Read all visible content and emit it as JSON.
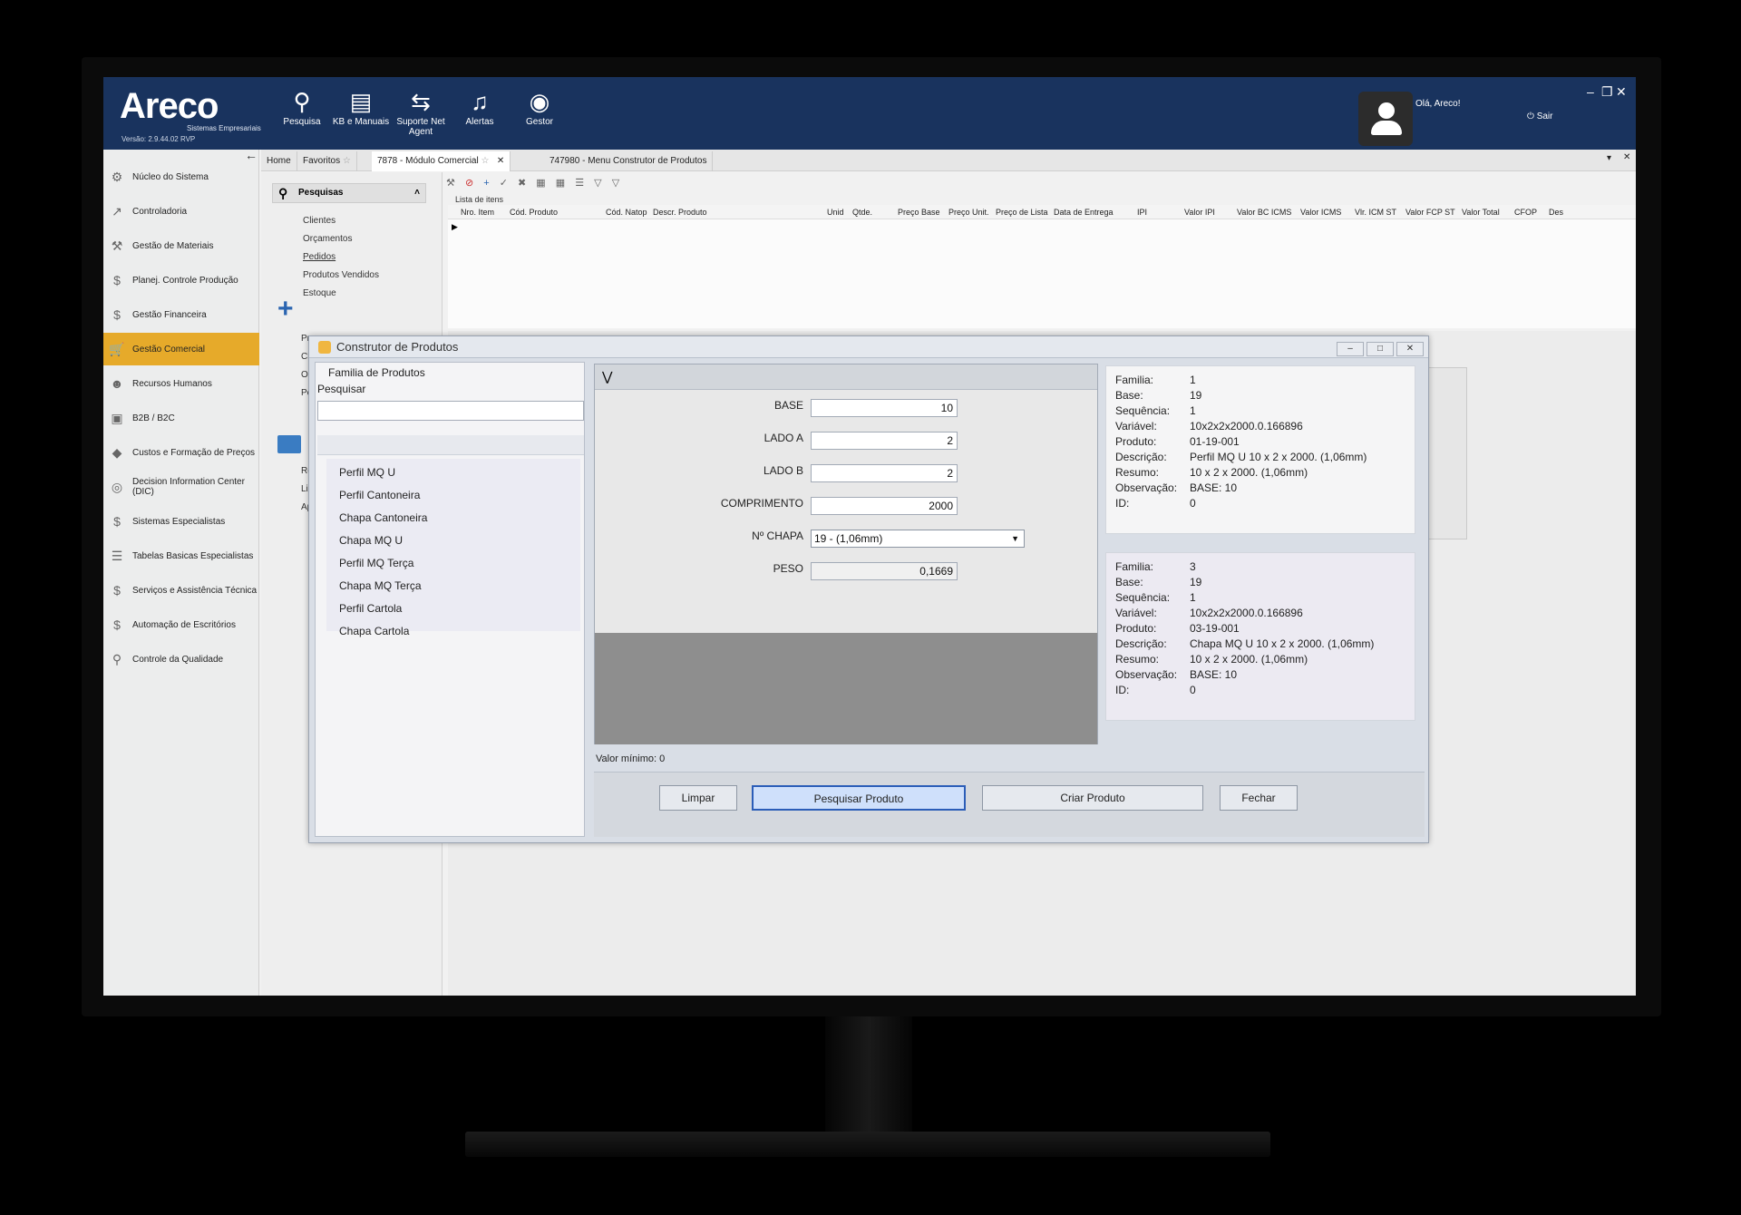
{
  "app": {
    "logo": "Areco",
    "logo_sub": "Sistemas Empresariais",
    "version": "Versão: 2.9.44.02 RVP"
  },
  "toolbar": [
    {
      "label": "Pesquisa",
      "icon": "search-icon"
    },
    {
      "label": "KB e Manuais",
      "icon": "book-icon"
    },
    {
      "label": "Suporte Net Agent",
      "icon": "support-icon"
    },
    {
      "label": "Alertas",
      "icon": "bell-icon"
    },
    {
      "label": "Gestor",
      "icon": "eye-icon"
    }
  ],
  "user": {
    "greeting": "Olá, Areco!",
    "logout": "Sair"
  },
  "sidebar": {
    "items": [
      {
        "label": "Núcleo do Sistema"
      },
      {
        "label": "Controladoria"
      },
      {
        "label": "Gestão de Materiais"
      },
      {
        "label": "Planej. Controle Produção"
      },
      {
        "label": "Gestão Financeira"
      },
      {
        "label": "Gestão Comercial"
      },
      {
        "label": "Recursos Humanos"
      },
      {
        "label": "B2B / B2C"
      },
      {
        "label": "Custos e Formação de Preços"
      },
      {
        "label": "Decision Information Center (DIC)"
      },
      {
        "label": "Sistemas Especialistas"
      },
      {
        "label": "Tabelas Basicas Especialistas"
      },
      {
        "label": "Serviços e Assistência Técnica"
      },
      {
        "label": "Automação de Escritórios"
      },
      {
        "label": "Controle da Qualidade"
      }
    ],
    "active": "Gestão Comercial"
  },
  "tabs": [
    {
      "label": "Home"
    },
    {
      "label": "Favoritos"
    },
    {
      "label": "7878 - Módulo Comercial"
    },
    {
      "label": "747980 - Menu Construtor de Produtos"
    }
  ],
  "left_panel": {
    "header": "Pesquisas",
    "links": [
      "Clientes",
      "Orçamentos",
      "Pedidos",
      "Produtos Vendidos",
      "Estoque"
    ],
    "stubs": [
      "Pr",
      "Cl",
      "Or",
      "Pe",
      "Re",
      "Lil",
      "Ap"
    ]
  },
  "grid": {
    "label": "Lista de itens",
    "columns": [
      "Nro. Item",
      "Cód. Produto",
      "Cód. Natop",
      "Descr. Produto",
      "Unid",
      "Qtde.",
      "Preço Base",
      "Preço Unit.",
      "Preço de Lista",
      "Data de Entrega",
      "IPI",
      "Valor IPI",
      "Valor BC ICMS",
      "Valor ICMS",
      "Vlr. ICM ST",
      "Valor FCP ST",
      "Valor Total",
      "CFOP",
      "Des"
    ]
  },
  "dialog": {
    "title": "Construtor de Produtos",
    "family_title": "Familia de Produtos",
    "search_label": "Pesquisar",
    "families": [
      "Perfil MQ U",
      "Perfil Cantoneira",
      "Chapa Cantoneira",
      "Chapa MQ U",
      "Perfil MQ Terça",
      "Chapa MQ Terça",
      "Perfil Cartola",
      "Chapa Cartola"
    ],
    "form": {
      "base_label": "BASE",
      "base_value": "10",
      "lado_a_label": "LADO A",
      "lado_a_value": "2",
      "lado_b_label": "LADO B",
      "lado_b_value": "2",
      "comprimento_label": "COMPRIMENTO",
      "comprimento_value": "2000",
      "chapa_label": "Nº CHAPA",
      "chapa_value": "19 - (1,06mm)",
      "peso_label": "PESO",
      "peso_value": "0,1669"
    },
    "min_value": "Valor mínimo: 0",
    "buttons": {
      "clear": "Limpar",
      "search": "Pesquisar Produto",
      "create": "Criar Produto",
      "close": "Fechar"
    },
    "cards": [
      {
        "familia_k": "Familia:",
        "familia": "1",
        "base_k": "Base:",
        "base": "19",
        "sequencia_k": "Sequência:",
        "sequencia": "1",
        "variavel_k": "Variável:",
        "variavel": "10x2x2x2000.0.166896",
        "produto_k": "Produto:",
        "produto": "01-19-001",
        "descricao_k": "Descrição:",
        "descricao": "Perfil MQ U 10 x 2 x 2000. (1,06mm)",
        "resumo_k": "Resumo:",
        "resumo": "10 x 2 x 2000. (1,06mm)",
        "observacao_k": "Observação:",
        "observacao": "BASE: 10",
        "id_k": "ID:",
        "id": "0"
      },
      {
        "familia_k": "Familia:",
        "familia": "3",
        "base_k": "Base:",
        "base": "19",
        "sequencia_k": "Sequência:",
        "sequencia": "1",
        "variavel_k": "Variável:",
        "variavel": "10x2x2x2000.0.166896",
        "produto_k": "Produto:",
        "produto": "03-19-001",
        "descricao_k": "Descrição:",
        "descricao": "Chapa MQ U 10 x 2 x 2000. (1,06mm)",
        "resumo_k": "Resumo:",
        "resumo": "10 x 2 x 2000. (1,06mm)",
        "observacao_k": "Observação:",
        "observacao": "BASE: 10",
        "id_k": "ID:",
        "id": "0"
      }
    ]
  },
  "colors": {
    "topbar": "#19335e",
    "active_module": "#e6aa2a",
    "primary_button_border": "#2b5db8"
  }
}
